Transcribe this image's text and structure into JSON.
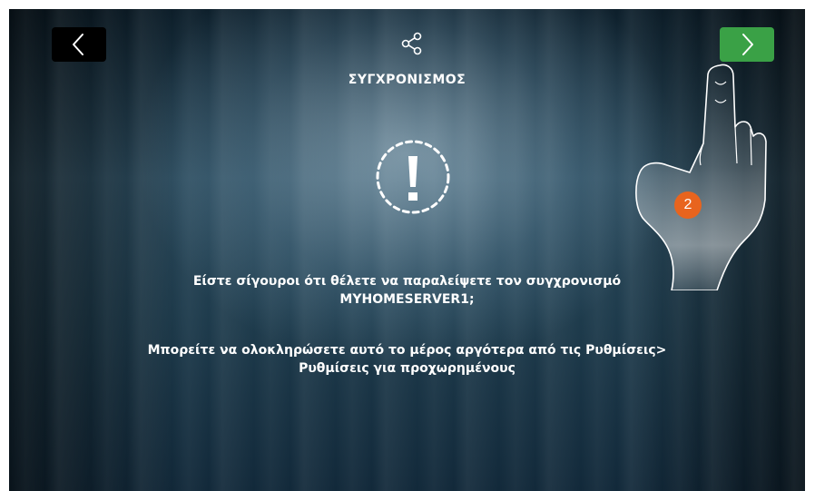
{
  "header": {
    "title": "ΣΥΓΧΡΟΝΙΣΜΟΣ",
    "share_icon": "share-icon",
    "back_icon": "chevron-left-icon",
    "next_icon": "chevron-right-icon"
  },
  "alert": {
    "icon": "exclamation-icon"
  },
  "message": {
    "line1": "Είστε σίγουροι ότι θέλετε να παραλείψετε τον συγχρονισμό",
    "line2": "MYHOMESERVER1;",
    "line3": "Μπορείτε να ολοκληρώσετε αυτό το μέρος αργότερα από τις Ρυθμίσεις>",
    "line4": "Ρυθμίσεις για προχωρημένους"
  },
  "tutorial": {
    "step_number": "2",
    "hand_icon": "pointing-hand-icon"
  },
  "colors": {
    "next_button": "#3aa146",
    "back_button": "#000000",
    "step_badge": "#e8641e",
    "text": "#ffffff"
  }
}
